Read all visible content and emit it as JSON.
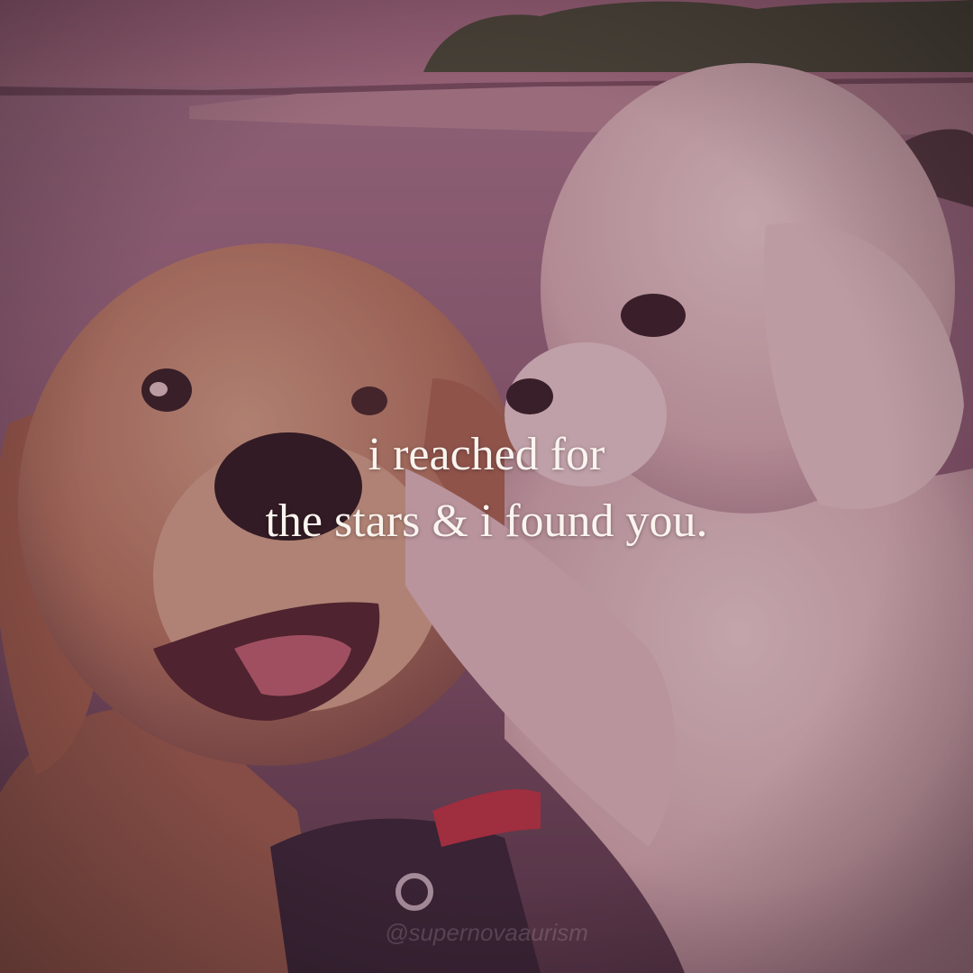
{
  "quote": {
    "line1": "i reached for",
    "line2": "the stars & i found you."
  },
  "watermark": "@supernovaaurism",
  "scene": {
    "subjects": [
      "golden-retriever-adult",
      "golden-retriever-puppy"
    ],
    "setting": "lakeshore at dusk",
    "overlay_tint": "#5a2a3e",
    "accent_colors": {
      "sky": "#a8708a",
      "water": "#9e6c84",
      "adult_dog_fur": "#c8906a",
      "puppy_fur": "#f2d8d8",
      "bandana": "#2a2030",
      "collar": "#c03040"
    }
  }
}
